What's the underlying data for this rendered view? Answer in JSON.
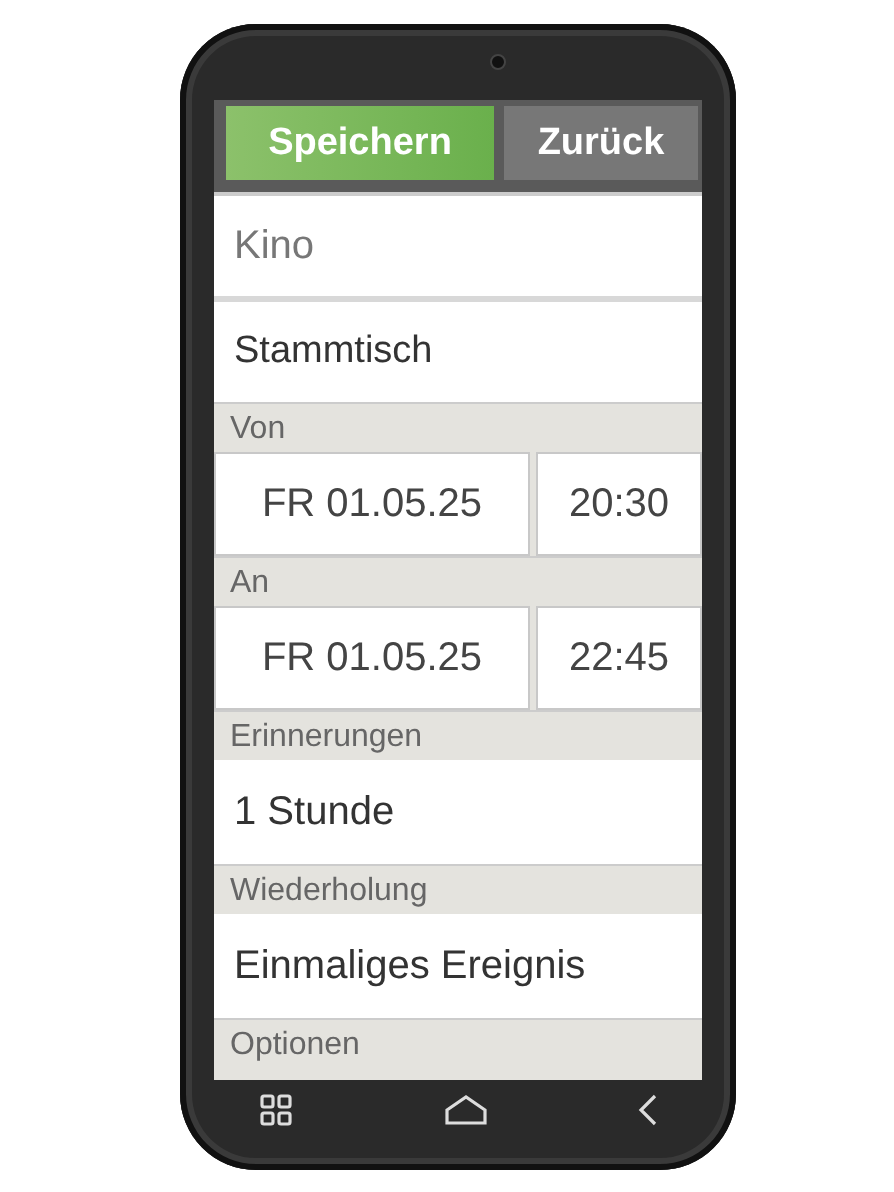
{
  "top_buttons": [
    {
      "label": "Speichern",
      "kind": "primary"
    },
    {
      "label": "Zurück",
      "kind": "secondary"
    }
  ],
  "title_field": {
    "placeholder": "Kino"
  },
  "location_field": {
    "value": "Stammtisch"
  },
  "sections": [
    {
      "label": "Von",
      "kind": "datetime",
      "date": "FR 01.05.25",
      "time": "20:30"
    },
    {
      "label": "An",
      "kind": "datetime",
      "date": "FR 01.05.25",
      "time": "22:45"
    },
    {
      "label": "Erinnerungen",
      "kind": "value",
      "value": "1 Stunde"
    },
    {
      "label": "Wiederholung",
      "kind": "value",
      "value": "Einmaliges Ereignis"
    },
    {
      "label": "Optionen",
      "kind": "header"
    }
  ]
}
